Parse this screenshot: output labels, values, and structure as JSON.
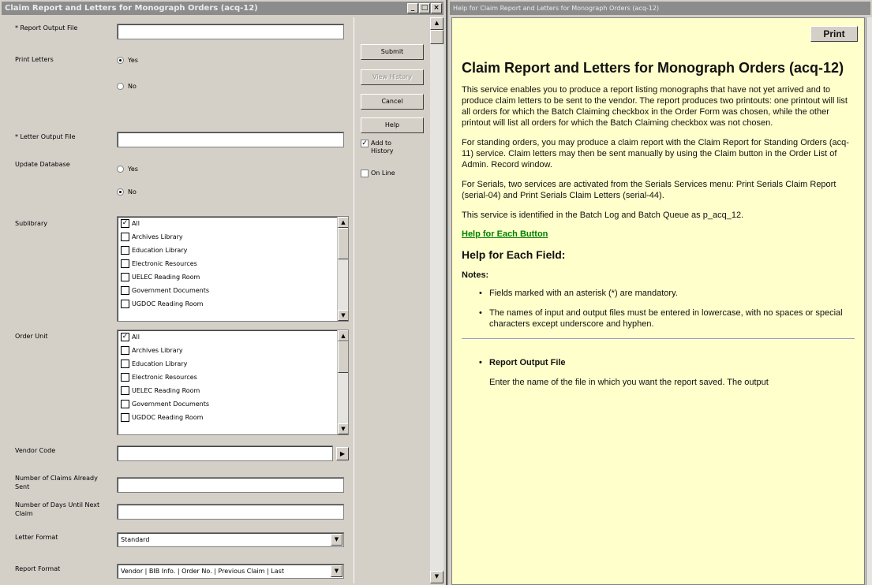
{
  "left_window": {
    "title": "Claim Report and Letters for Monograph Orders (acq-12)",
    "controls": {
      "minimize": "_",
      "maximize": "□",
      "close": "×"
    }
  },
  "form": {
    "report_output_file": {
      "label": "* Report Output File",
      "value": ""
    },
    "print_letters": {
      "label": "Print Letters",
      "options": [
        "Yes",
        "No"
      ],
      "selected": "Yes"
    },
    "letter_output_file": {
      "label": "* Letter Output File",
      "value": ""
    },
    "update_database": {
      "label": "Update Database",
      "options": [
        "Yes",
        "No"
      ],
      "selected": "No"
    },
    "sublibrary": {
      "label": "Sublibrary",
      "items": [
        {
          "label": "All",
          "checked": true
        },
        {
          "label": "Archives Library",
          "checked": false
        },
        {
          "label": "Education Library",
          "checked": false
        },
        {
          "label": "Electronic Resources",
          "checked": false
        },
        {
          "label": "UELEC Reading Room",
          "checked": false
        },
        {
          "label": "Government Documents",
          "checked": false
        },
        {
          "label": "UGDOC Reading Room",
          "checked": false
        }
      ]
    },
    "order_unit": {
      "label": "Order Unit",
      "items": [
        {
          "label": "All",
          "checked": true
        },
        {
          "label": "Archives Library",
          "checked": false
        },
        {
          "label": "Education Library",
          "checked": false
        },
        {
          "label": "Electronic Resources",
          "checked": false
        },
        {
          "label": "UELEC Reading Room",
          "checked": false
        },
        {
          "label": "Government Documents",
          "checked": false
        },
        {
          "label": "UGDOC Reading Room",
          "checked": false
        }
      ]
    },
    "vendor_code": {
      "label": "Vendor Code",
      "value": ""
    },
    "claims_sent": {
      "label": "Number of Claims Already Sent",
      "value": ""
    },
    "days_until_next": {
      "label": "Number of Days Until Next Claim",
      "value": ""
    },
    "letter_format": {
      "label": "Letter Format",
      "value": "Standard"
    },
    "report_format": {
      "label": "Report Format",
      "value": "Vendor | BIB Info. | Order No. | Previous Claim | Last"
    }
  },
  "buttons": {
    "submit": "Submit",
    "view_history": "View History",
    "cancel": "Cancel",
    "help": "Help",
    "add_to_history": {
      "label": "Add to History",
      "checked": true
    },
    "on_line": {
      "label": "On Line",
      "checked": false
    }
  },
  "help_window": {
    "title": "Help for Claim Report and Letters for Monograph Orders (acq-12)",
    "print_label": "Print",
    "heading": "Claim Report and Letters for Monograph Orders (acq-12)",
    "paragraphs": [
      "This service enables you to produce a report listing monographs that have not yet arrived and to produce claim letters to be sent to the vendor. The report produces two printouts: one printout will list all orders for which the Batch Claiming checkbox in the Order Form was chosen, while the other printout will list all orders for which the Batch Claiming checkbox was not chosen.",
      "For standing orders, you may produce a claim report with the Claim Report for Standing Orders (acq-11) service. Claim letters may then be sent manually by using the Claim button in the Order List of Admin. Record window.",
      "For Serials, two services are activated from the Serials Services menu: Print Serials Claim Report (serial-04) and Print Serials Claim Letters (serial-44).",
      "This service is identified in the Batch Log and Batch Queue as p_acq_12."
    ],
    "link": "Help for Each Button",
    "fields_heading": "Help for Each Field:",
    "notes_label": "Notes:",
    "notes": [
      "Fields marked with an asterisk (*) are mandatory.",
      "The names of input and output files must be entered in lowercase, with no spaces or special characters except underscore and hyphen."
    ],
    "field_title": "Report Output File",
    "field_desc": "Enter the name of the file in which you want the report saved. The output"
  }
}
